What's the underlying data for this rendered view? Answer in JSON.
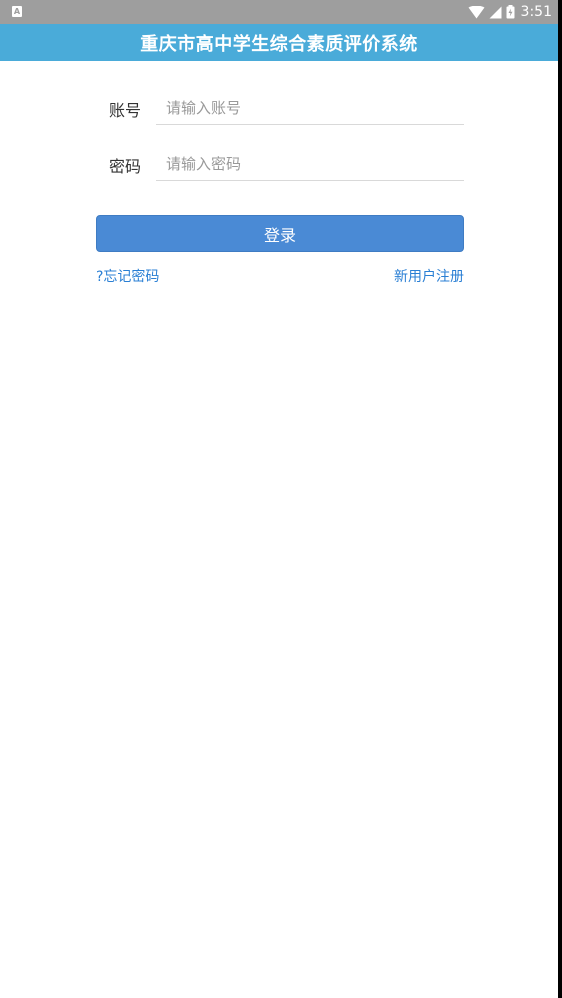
{
  "status_bar": {
    "time": "3:51",
    "left_icon": "A"
  },
  "header": {
    "title": "重庆市高中学生综合素质评价系统"
  },
  "login_form": {
    "account_label": "账号",
    "account_placeholder": "请输入账号",
    "account_value": "",
    "password_label": "密码",
    "password_placeholder": "请输入密码",
    "password_value": "",
    "login_button_label": "登录"
  },
  "links": {
    "forgot_password": "?忘记密码",
    "register": "新用户注册"
  },
  "icons": {
    "status_notification": "a-box-icon",
    "wifi": "wifi-icon",
    "signal": "cell-signal-icon",
    "battery": "battery-charging-icon"
  },
  "colors": {
    "status_bar_bg": "#9e9e9e",
    "title_bar_bg": "#4aabd9",
    "button_bg": "#4a8ad5",
    "link_color": "#2a7fd4"
  }
}
